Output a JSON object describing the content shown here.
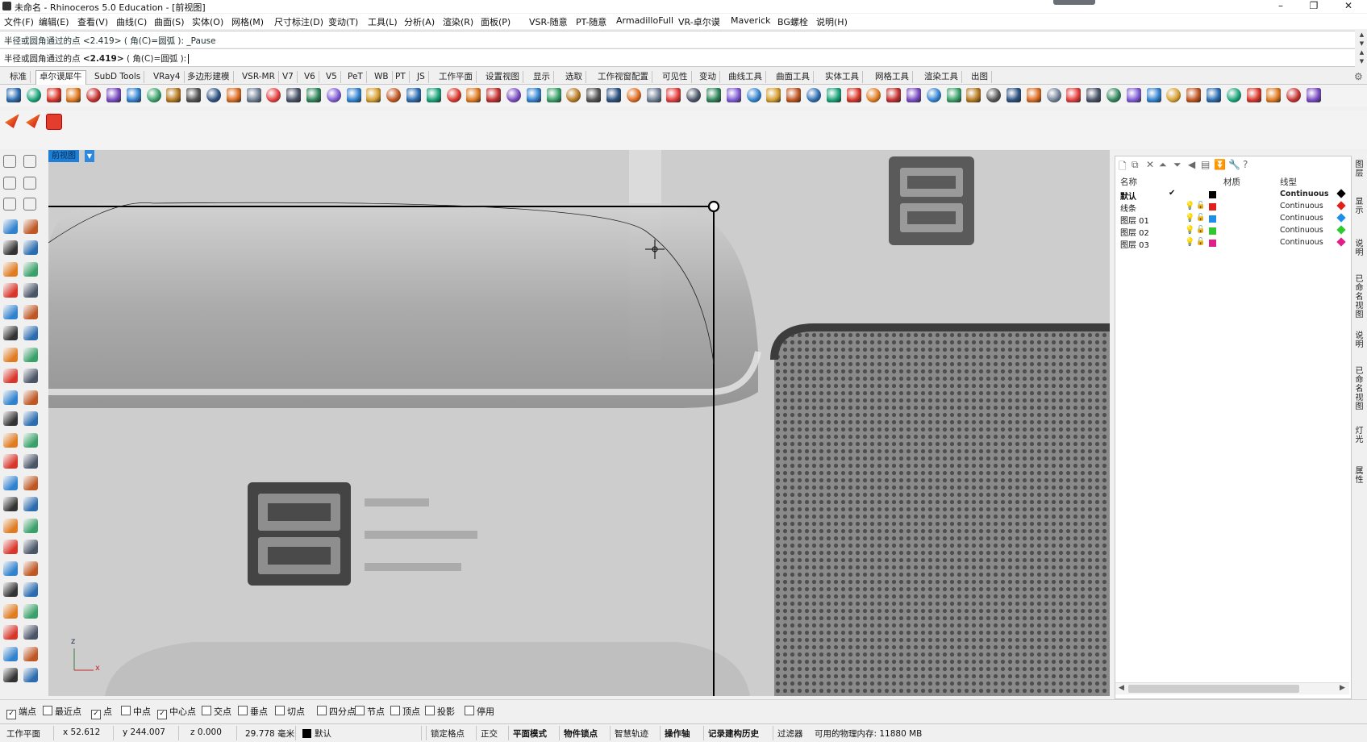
{
  "window": {
    "title": "未命名 - Rhinoceros 5.0 Education - [前视图]",
    "minimize": "–",
    "restore": "❐",
    "close": "✕"
  },
  "menubar": [
    "文件(F)",
    "编辑(E)",
    "查看(V)",
    "曲线(C)",
    "曲面(S)",
    "实体(O)",
    "网格(M)",
    "尺寸标注(D)",
    "变动(T)",
    "工具(L)",
    "分析(A)",
    "渲染(R)",
    "面板(P)",
    "VSR-随意",
    "PT-随意",
    "ArmadilloFull",
    "VR-卓尔谟",
    "Maverick",
    "BG螺栓",
    "说明(H)"
  ],
  "command": {
    "history": "半径或圆角通过的点 <2.419> ( 角(C)=圆弧 ): _Pause",
    "prompt_before": "半径或圆角通过的点 ",
    "prompt_value": "<2.419>",
    "prompt_after": " ( 角(C)=圆弧 ):"
  },
  "toolbar_tabs": [
    "标准",
    "卓尔谟犀牛",
    "SubD Tools",
    "VRay4",
    "多边形建模",
    "VSR-MR",
    "V7",
    "V6",
    "V5",
    "PeT",
    "WB",
    "PT",
    "JS",
    "工作平面",
    "设置视图",
    "显示",
    "选取",
    "工作视窗配置",
    "可见性",
    "变动",
    "曲线工具",
    "曲面工具",
    "实体工具",
    "网格工具",
    "渲染工具",
    "出图"
  ],
  "active_tab_index": 1,
  "viewport": {
    "label": "前视图",
    "axis_z": "z",
    "axis_x": "x"
  },
  "layers": {
    "columns": {
      "name": "名称",
      "material": "材质",
      "linetype": "线型"
    },
    "rows": [
      {
        "name": "默认",
        "current": "✔",
        "color": "#000000",
        "linetype": "Continuous",
        "bold": true
      },
      {
        "name": "线条",
        "current": "",
        "color": "#e0201b",
        "linetype": "Continuous",
        "bold": false
      },
      {
        "name": "图层 01",
        "current": "",
        "color": "#1e8fe8",
        "linetype": "Continuous",
        "bold": false
      },
      {
        "name": "图层 02",
        "current": "",
        "color": "#2ec92e",
        "linetype": "Continuous",
        "bold": false
      },
      {
        "name": "图层 03",
        "current": "",
        "color": "#e0208a",
        "linetype": "Continuous",
        "bold": false
      }
    ]
  },
  "side_tabs": [
    "图层",
    "显示",
    "说明",
    "已命名视图",
    "说明",
    "已命名视图",
    "灯光",
    "属性"
  ],
  "osnaps": [
    {
      "label": "端点",
      "checked": true
    },
    {
      "label": "最近点",
      "checked": false
    },
    {
      "label": "点",
      "checked": true
    },
    {
      "label": "中点",
      "checked": false
    },
    {
      "label": "中心点",
      "checked": true
    },
    {
      "label": "交点",
      "checked": false
    },
    {
      "label": "垂点",
      "checked": false
    },
    {
      "label": "切点",
      "checked": false
    },
    {
      "label": "四分点",
      "checked": false
    },
    {
      "label": "节点",
      "checked": false
    },
    {
      "label": "顶点",
      "checked": false
    },
    {
      "label": "投影",
      "checked": false
    },
    {
      "label": "停用",
      "checked": false
    }
  ],
  "status": {
    "cplane": "工作平面",
    "x": "x 52.612",
    "y": "y 244.007",
    "z": "z 0.000",
    "units": "29.778 毫米",
    "layer": "默认",
    "toggles": [
      "锁定格点",
      "正交",
      "平面模式",
      "物件锁点",
      "智慧轨迹",
      "操作轴",
      "记录建构历史",
      "过滤器"
    ],
    "memory": "可用的物理内存: 11880 MB"
  },
  "colors": {
    "accent": "#1f7fd4",
    "viewport_bg": "#cacaca"
  }
}
